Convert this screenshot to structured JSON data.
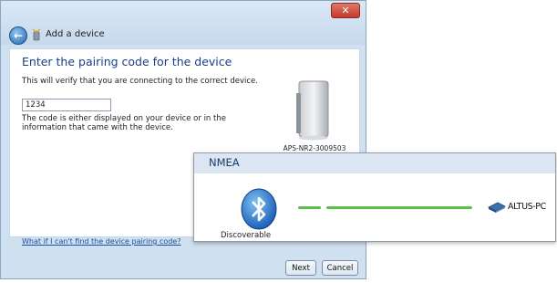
{
  "window": {
    "title": "Add a device",
    "close_label": "✕",
    "back_label": "←"
  },
  "pairing": {
    "heading": "Enter the pairing code for the device",
    "description": "This will verify that you are connecting to the correct device.",
    "code_value": "1234",
    "hint": "The code is either displayed on your device or in the information that came with the device.",
    "device_name": "APS-NR2-3009503",
    "help_link": "What if I can't find the device pairing code?"
  },
  "buttons": {
    "next": "Next",
    "cancel": "Cancel"
  },
  "nmea_panel": {
    "title": "NMEA",
    "status": "Discoverable",
    "target_device": "ALTUS-PC",
    "icons": [
      "bluetooth-icon",
      "laptop-icon"
    ],
    "link_color": "#5cbf4a"
  },
  "colors": {
    "heading": "#1a3e8a",
    "link": "#1a4fa0",
    "window_frame": "#cfe0f0"
  }
}
